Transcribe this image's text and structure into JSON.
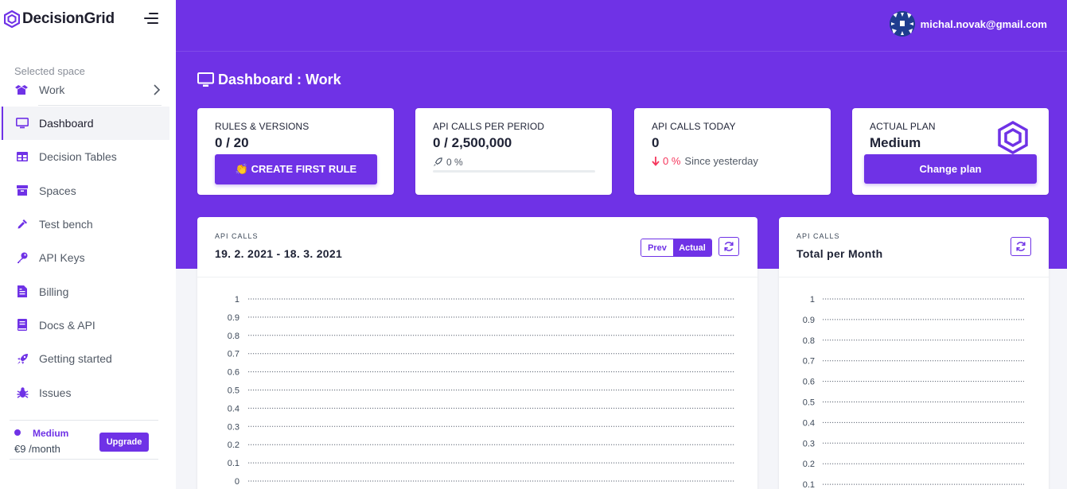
{
  "brand": {
    "name": "DecisionGrid",
    "logo_icon": "hexagon-logo-icon"
  },
  "sidebar": {
    "space_caption": "Selected space",
    "space_name": "Work",
    "items": [
      {
        "label": "Dashboard",
        "icon": "monitor-icon",
        "active": true
      },
      {
        "label": "Decision Tables",
        "icon": "table-icon"
      },
      {
        "label": "Spaces",
        "icon": "box-icon"
      },
      {
        "label": "Test bench",
        "icon": "eyedropper-icon"
      },
      {
        "label": "API Keys",
        "icon": "key-icon"
      },
      {
        "label": "Billing",
        "icon": "invoice-icon"
      },
      {
        "label": "Docs & API",
        "icon": "book-icon"
      },
      {
        "label": "Getting started",
        "icon": "rocket-icon"
      },
      {
        "label": "Issues",
        "icon": "bug-icon"
      }
    ],
    "plan": {
      "name": "Medium",
      "price": "€9 /month",
      "upgrade_label": "Upgrade"
    }
  },
  "header": {
    "user_email": "michal.novak@gmail.com"
  },
  "page": {
    "title": "Dashboard : Work"
  },
  "stats": {
    "rules": {
      "caption": "RULES & VERSIONS",
      "value": "0 / 20",
      "button_label": "👏 CREATE FIRST RULE"
    },
    "api_period": {
      "caption": "API CALLS PER PERIOD",
      "value": "0 / 2,500,000",
      "percent_label": "0 %",
      "progress": 0
    },
    "api_today": {
      "caption": "API CALLS TODAY",
      "value": "0",
      "change_label": "0 %",
      "change_text": "Since yesterday"
    },
    "plan": {
      "caption": "ACTUAL PLAN",
      "value": "Medium",
      "button_label": "Change plan"
    }
  },
  "colors": {
    "accent": "#6f32e6",
    "danger": "#f5365c"
  },
  "charts": {
    "api_calls": {
      "kicker": "API CALLS",
      "title": "19. 2. 2021 - 18. 3. 2021",
      "prev_label": "Prev",
      "actual_label": "Actual"
    },
    "monthly": {
      "kicker": "API CALLS",
      "title": "Total per Month"
    }
  },
  "chart_data": [
    {
      "type": "line",
      "title": "19. 2. 2021 - 18. 3. 2021",
      "y_ticks": [
        "1",
        "0.9",
        "0.8",
        "0.7",
        "0.6",
        "0.5",
        "0.4",
        "0.3",
        "0.2",
        "0.1",
        "0"
      ],
      "ylim": [
        0,
        1
      ],
      "grid": true,
      "series": []
    },
    {
      "type": "bar",
      "title": "Total per Month",
      "y_ticks": [
        "1",
        "0.9",
        "0.8",
        "0.7",
        "0.6",
        "0.5",
        "0.4",
        "0.3",
        "0.2",
        "0.1"
      ],
      "ylim": [
        0,
        1
      ],
      "grid": true,
      "series": []
    }
  ]
}
